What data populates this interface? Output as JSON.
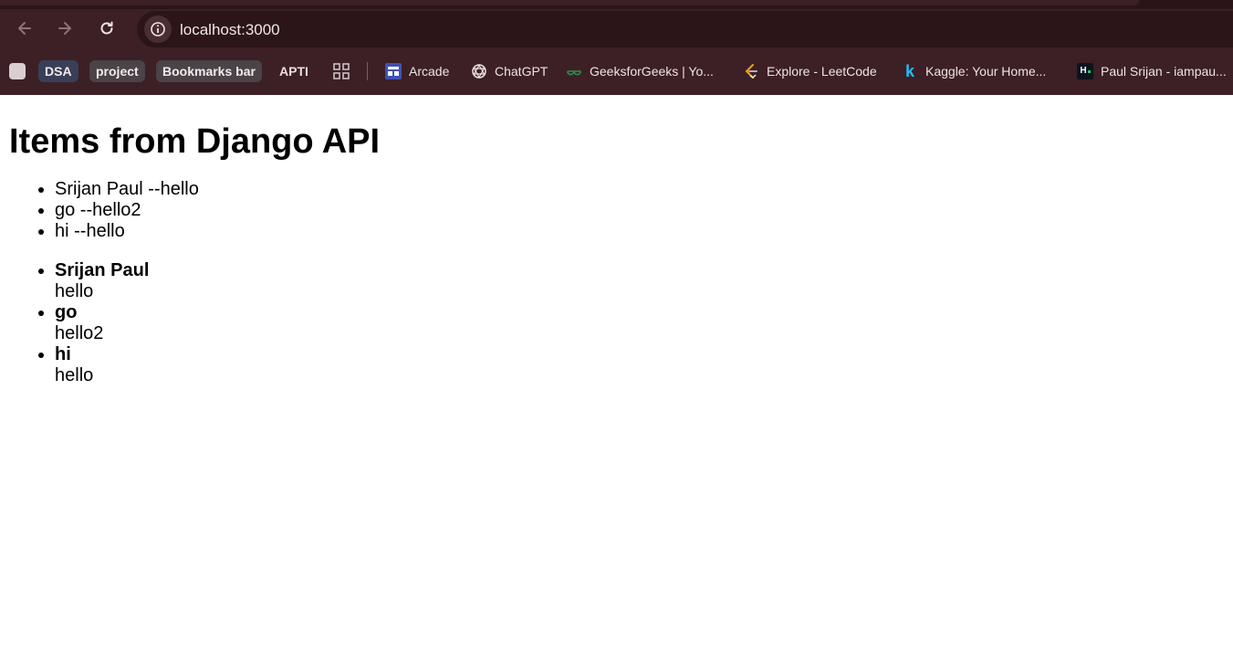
{
  "browser": {
    "url": "localhost:3000",
    "bookmarks": [
      {
        "label": "DSA",
        "type": "folder-chip"
      },
      {
        "label": "project",
        "type": "folder-chip"
      },
      {
        "label": "Bookmarks bar",
        "type": "folder-chip"
      },
      {
        "label": "APTI",
        "type": "text"
      },
      {
        "label": "Arcade",
        "icon": "arcade-icon"
      },
      {
        "label": "ChatGPT",
        "icon": "chatgpt-icon"
      },
      {
        "label": "GeeksforGeeks | Yo...",
        "icon": "geeksforgeeks-icon"
      },
      {
        "label": "Explore - LeetCode",
        "icon": "leetcode-icon"
      },
      {
        "label": "Kaggle: Your Home...",
        "icon": "kaggle-icon"
      },
      {
        "label": "Paul Srijan - iampau...",
        "icon": "hackerrank-icon"
      }
    ]
  },
  "page": {
    "title": "Items from Django API",
    "list1": [
      "Srijan Paul --hello",
      "go --hello2",
      "hi --hello"
    ],
    "list2": [
      {
        "name": "Srijan Paul",
        "desc": "hello"
      },
      {
        "name": "go",
        "desc": "hello2"
      },
      {
        "name": "hi",
        "desc": "hello"
      }
    ]
  },
  "colors": {
    "chrome_bg": "#3c2026",
    "omnibox_bg": "#2b1519",
    "chip_dsa": "#3a3f58",
    "chip_project": "#4a4347",
    "chip_bookmarks": "#4a4347"
  }
}
